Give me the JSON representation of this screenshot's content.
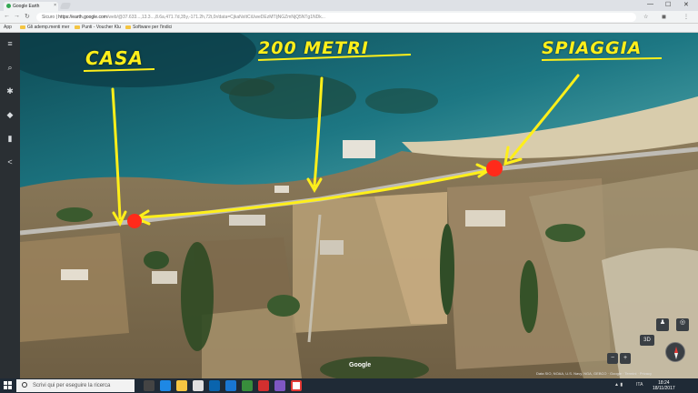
{
  "browser": {
    "tab_title": "Google Earth",
    "tab_close": "×",
    "window_controls": {
      "minimize": "—",
      "maximize": "☐",
      "close": "✕"
    },
    "address": {
      "secure_label": "Sicuro",
      "host": "https://earth.google.com",
      "rest": "/web/@37.633...,13.3...,8.6a,471.7d,35y,-171.2h,72t,0r/data=CjkaNxItCiUweDEzMTljNGZmNjQ5NTg1NDk..."
    },
    "bookmarks": [
      {
        "label": "App"
      },
      {
        "label": "Gli ademp.menti mer"
      },
      {
        "label": "Punti - Voucher Klu"
      },
      {
        "label": "Software per l'indici"
      }
    ]
  },
  "earth": {
    "labels": {
      "casa": "CASA",
      "distance": "200 METRI",
      "spiaggia": "SPIAGGIA"
    },
    "logo": "Google",
    "attribution": "Data SIO, NOAA, U.S. Navy, NGA, GEBCO · Google · Termini · Privacy",
    "zoom_in": "+",
    "zoom_out": "−",
    "view_3d": "3D",
    "annotation_color": "#ffef1a",
    "marker_color": "#ff2a1a",
    "rail_icons": [
      "menu-icon",
      "search-icon",
      "voyager-icon",
      "feeling-lucky-icon",
      "projects-icon",
      "share-icon"
    ]
  },
  "taskbar": {
    "search_placeholder": "Scrivi qui per eseguire la ricerca",
    "time": "18:24",
    "date": "18/11/2017",
    "tray_language": "ITA"
  }
}
